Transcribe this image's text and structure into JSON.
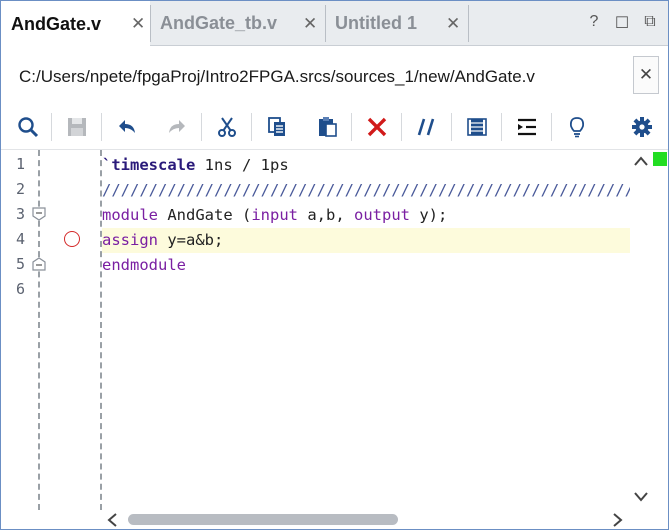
{
  "tabs": [
    {
      "label": "AndGate.v",
      "close": "✕",
      "active": true
    },
    {
      "label": "AndGate_tb.v",
      "close": "✕",
      "active": false
    },
    {
      "label": "Untitled 1",
      "close": "✕",
      "active": false
    }
  ],
  "window_buttons": {
    "help": "?",
    "restore": "☐",
    "float": "⧉"
  },
  "path": "C:/Users/npete/fpgaProj/Intro2FPGA.srcs/sources_1/new/AndGate.v",
  "path_close": "✕",
  "toolbar_icons": [
    "search-icon",
    "save-icon",
    "undo-icon",
    "redo-icon",
    "cut-icon",
    "copy-icon",
    "paste-icon",
    "delete-icon",
    "comment-icon",
    "column-select-icon",
    "indent-icon",
    "bulb-icon",
    "gear-icon"
  ],
  "editor": {
    "line_numbers": [
      "1",
      "2",
      "3",
      "4",
      "5",
      "6"
    ],
    "lines": {
      "l1_directive": "`timescale",
      "l1_rest": " 1ns / 1ps",
      "l2_comment": "////////////////////////////////////////////////////////////////",
      "l3_module": "module",
      "l3_name": " AndGate (",
      "l3_input": "input",
      "l3_ab": " a,b, ",
      "l3_output": "output",
      "l3_end": " y);",
      "l4_assign": "assign",
      "l4_rest": " y=a&b;",
      "l5_endmodule": "endmodule"
    },
    "current_line": 4
  },
  "colors": {
    "keyword": "#7a1fa2",
    "breakpoint": "#d42a2a",
    "overview_ok": "#22dd22",
    "current_line_bg": "#fdfbdc"
  }
}
